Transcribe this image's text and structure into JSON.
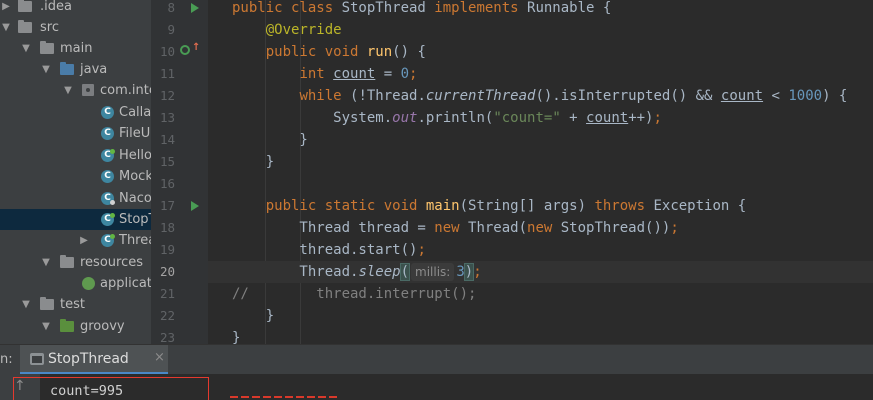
{
  "project_tree": [
    {
      "label": ".idea",
      "icon": "folder-icon",
      "indent": 0,
      "expanded": false
    },
    {
      "label": "src",
      "icon": "folder-icon",
      "indent": 0,
      "expanded": true
    },
    {
      "label": "main",
      "icon": "folder-icon",
      "indent": 1,
      "expanded": true
    },
    {
      "label": "java",
      "icon": "source-folder-icon",
      "indent": 2,
      "expanded": true
    },
    {
      "label": "com.inte",
      "icon": "package-icon",
      "indent": 3,
      "expanded": true
    },
    {
      "label": "Callab",
      "icon": "class-icon",
      "indent": 4
    },
    {
      "label": "FileU",
      "icon": "class-icon",
      "indent": 4
    },
    {
      "label": "Hello",
      "icon": "class-icon",
      "indent": 4
    },
    {
      "label": "Mock",
      "icon": "class-icon",
      "indent": 4
    },
    {
      "label": "Naco",
      "icon": "class-icon",
      "indent": 4
    },
    {
      "label": "StopT",
      "icon": "class-icon",
      "indent": 4,
      "selected": true
    },
    {
      "label": "Threa",
      "icon": "class-icon",
      "indent": 4,
      "expanded": false
    },
    {
      "label": "resources",
      "icon": "resources-folder-icon",
      "indent": 2,
      "expanded": true
    },
    {
      "label": "applicati",
      "icon": "config-file-icon",
      "indent": 3
    },
    {
      "label": "test",
      "icon": "folder-icon",
      "indent": 1,
      "expanded": true
    },
    {
      "label": "groovy",
      "icon": "test-folder-icon",
      "indent": 2,
      "expanded": true
    }
  ],
  "gutter": {
    "lines": [
      "8",
      "9",
      "10",
      "11",
      "12",
      "13",
      "14",
      "15",
      "16",
      "17",
      "18",
      "19",
      "20",
      "21",
      "22",
      "23"
    ],
    "current_line": "20"
  },
  "code": {
    "l8": {
      "t1": "public class ",
      "t2": "StopThread ",
      "t3": "implements ",
      "t4": "Runnable {"
    },
    "l9": {
      "t1": "    ",
      "t2": "@Override"
    },
    "l10": {
      "t1": "    ",
      "t2": "public void ",
      "t3": "run",
      "t4": "() {"
    },
    "l11": {
      "t1": "        ",
      "t2": "int ",
      "t3": "count",
      "t4": " = ",
      "t5": "0",
      "t6": ";"
    },
    "l12": {
      "t1": "        ",
      "t2": "while ",
      "t3": "(!Thread.",
      "t4": "currentThread",
      "t5": "().isInterrupted() ",
      "t6": "&& ",
      "t7": "count",
      "t8": " < ",
      "t9": "1000",
      "t10": ") {"
    },
    "l13": {
      "t1": "            System.",
      "t2": "out",
      "t3": ".println(",
      "t4": "\"count=\"",
      "t5": " + ",
      "t6": "count",
      "t7": "++)",
      "t8": ";"
    },
    "l14": {
      "t1": "        }"
    },
    "l15": {
      "t1": "    }"
    },
    "l16": {
      "t1": ""
    },
    "l17": {
      "t1": "    ",
      "t2": "public static void ",
      "t3": "main",
      "t4": "(String[] args) ",
      "t5": "throws ",
      "t6": "Exception {"
    },
    "l18": {
      "t1": "        Thread thread = ",
      "t2": "new ",
      "t3": "Thread(",
      "t4": "new ",
      "t5": "StopThread())",
      "t6": ";"
    },
    "l19": {
      "t1": "        thread.start()",
      "t2": ";"
    },
    "l20": {
      "t1": "        Thread.",
      "t2": "sleep",
      "t3": "(",
      "hint": "millis:",
      "t4": "3",
      "t5": ")",
      "t6": ";"
    },
    "l21": {
      "t1": "//        thread.interrupt();"
    },
    "l22": {
      "t1": "    }"
    },
    "l23": {
      "t1": "}"
    }
  },
  "run_panel": {
    "label": "n:",
    "tab_label": "StopThread",
    "close_glyph": "×"
  },
  "console": {
    "output_line": "count=995",
    "up_glyph": "↑"
  }
}
